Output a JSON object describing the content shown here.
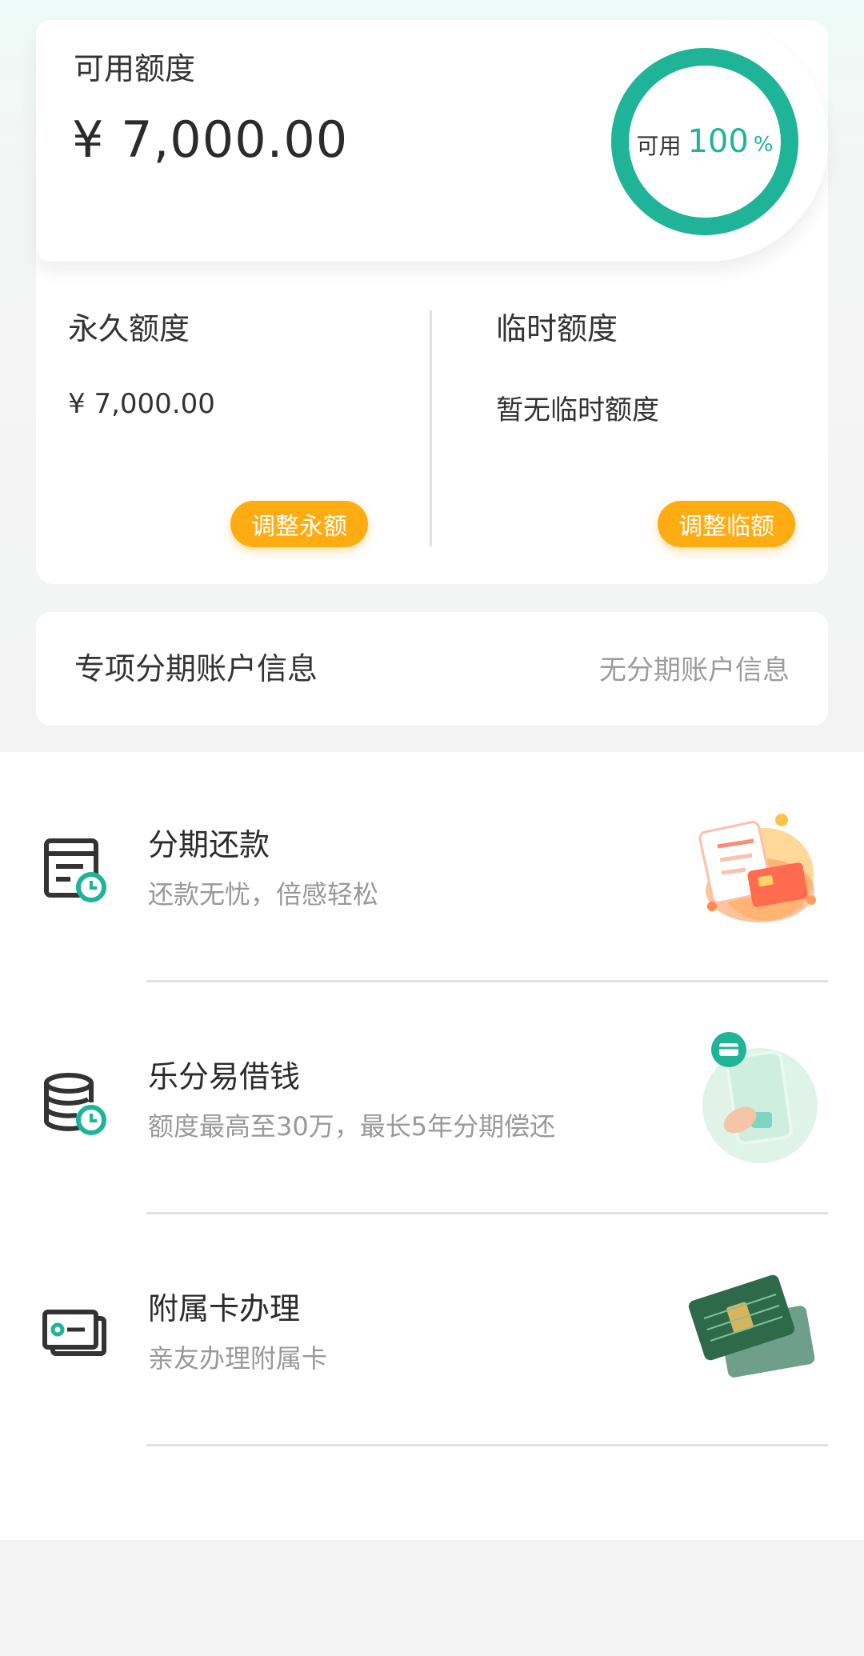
{
  "colors": {
    "accent": "#1fb497",
    "button": "#ffab12",
    "text": "#333333",
    "muted": "#999999"
  },
  "credit": {
    "available_label": "可用额度",
    "available_amount": "¥ 7,000.00",
    "ring": {
      "prefix": "可用",
      "value": "100",
      "unit": "%",
      "fraction": 1.0
    },
    "permanent": {
      "title": "永久额度",
      "value": "¥ 7,000.00",
      "button": "调整永额"
    },
    "temporary": {
      "title": "临时额度",
      "value": "暂无临时额度",
      "button": "调整临额"
    }
  },
  "installment_info": {
    "title": "专项分期账户信息",
    "value": "无分期账户信息"
  },
  "services": [
    {
      "title": "分期还款",
      "subtitle": "还款无忧，倍感轻松",
      "icon": "bill-clock-icon",
      "illustration": "bill-card-illustration"
    },
    {
      "title": "乐分易借钱",
      "subtitle": "额度最高至30万，最长5年分期偿还",
      "icon": "coins-clock-icon",
      "illustration": "phone-card-illustration"
    },
    {
      "title": "附属卡办理",
      "subtitle": "亲友办理附属卡",
      "icon": "card-icon",
      "illustration": "credit-card-illustration"
    }
  ]
}
